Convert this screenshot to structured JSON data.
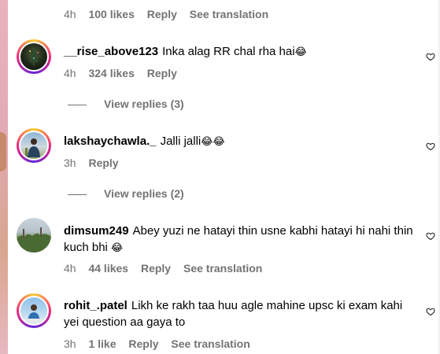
{
  "comments": [
    {
      "time": "4h",
      "likes": "100 likes",
      "reply": "Reply",
      "translation": "See translation"
    },
    {
      "username": "__rise_above123",
      "text": "Inka alag RR chal rha hai",
      "emoji": "😂",
      "time": "4h",
      "likes": "324 likes",
      "reply": "Reply",
      "view_replies": "View replies (3)"
    },
    {
      "username": "lakshaychawla._",
      "text": "Jalli jalli",
      "emoji": "😂😂",
      "time": "3h",
      "reply": "Reply",
      "view_replies": "View replies (2)"
    },
    {
      "username": "dimsum249",
      "text": "Abey yuzi ne hatayi thin usne kabhi hatayi hi nahi thin kuch bhi",
      "emoji": "😂",
      "time": "4h",
      "likes": "44 likes",
      "reply": "Reply",
      "translation": "See translation"
    },
    {
      "username": "rohit_.patel",
      "text": "Likh ke rakh taa huu agle mahine upsc ki exam kahi yei question aa gaya to",
      "time": "3h",
      "likes": "1 like",
      "reply": "Reply",
      "translation": "See translation"
    }
  ],
  "icons": {
    "like": "heart-outline-icon"
  },
  "colors": {
    "meta_gray": "#737373",
    "text": "#000000",
    "story_ring": [
      "#f9ce34",
      "#ee2a7b",
      "#6228d7"
    ]
  }
}
